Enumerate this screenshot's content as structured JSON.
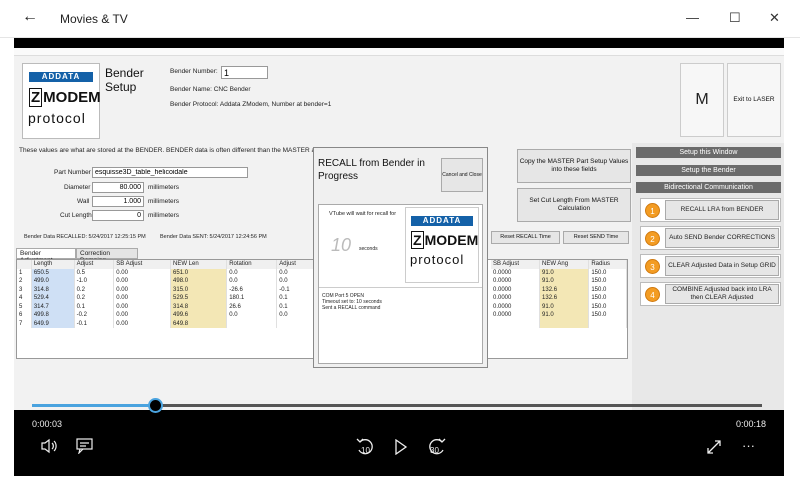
{
  "window": {
    "back": "←",
    "title": "Movies & TV",
    "min": "—",
    "max": "☐",
    "close": "✕"
  },
  "header": {
    "bender_setup_l1": "Bender",
    "bender_setup_l2": "Setup",
    "bender_number_label": "Bender Number:",
    "bender_number_value": "1",
    "bender_name": "Bender Name: CNC Bender",
    "bender_protocol": "Bender Protocol: Addata ZModem, Number at bender=1",
    "m_label": "M",
    "exit_label": "Exit to LASER"
  },
  "logo": {
    "brand": "ADDATA",
    "z": "Z",
    "modem": "MODEM",
    "protocol": "protocol"
  },
  "info": {
    "note": "These values are what are stored at the BENDER.  BENDER data is often different than the MASTER and",
    "part_label": "Part Number",
    "part_value": "esquisse3D_table_helicoidale",
    "diam_label": "Diameter",
    "diam_value": "80.000",
    "diam_unit": "millimeters",
    "wall_label": "Wall",
    "wall_value": "1.000",
    "wall_unit": "millimeters",
    "cut_label": "Cut Length",
    "cut_value": "0",
    "cut_unit": "millimeters",
    "recalled": "Bender Data RECALLED:  5/24/2017 12:25:15 PM",
    "sent": "Bender Data SENT:  5/24/2017 12:24:56 PM"
  },
  "buttons": {
    "copy_master": "Copy the MASTER Part Setup Values into these fields",
    "set_cut": "Set Cut Length From MASTER Calculation",
    "reset_recall": "Reset RECALL Time",
    "reset_send": "Reset SEND Time"
  },
  "right": {
    "h1": "Setup this Window",
    "h2": "Setup the Bender",
    "h3": "Bidirectional Communication",
    "actions": [
      {
        "num": "1",
        "label": "RECALL LRA from BENDER"
      },
      {
        "num": "2",
        "label": "Auto SEND Bender CORRECTIONS"
      },
      {
        "num": "3",
        "label": "CLEAR Adjusted Data in Setup GRID"
      },
      {
        "num": "4",
        "label": "COMBINE Adjusted back into LRA then CLEAR Adjusted"
      }
    ]
  },
  "tabs": [
    "Bender Adjustment",
    "Correction Damping"
  ],
  "grid": {
    "headers": [
      "",
      "Length",
      "Adjust",
      "SB Adjust",
      "NEW Len",
      "Rotation",
      "Adjust"
    ],
    "rows": [
      [
        "1",
        "650.5",
        "0.5",
        "0.00",
        "651.0",
        "0.0",
        "0.0"
      ],
      [
        "2",
        "499.0",
        "-1.0",
        "0.00",
        "498.0",
        "0.0",
        "0.0"
      ],
      [
        "3",
        "314.8",
        "0.2",
        "0.00",
        "315.0",
        "-26.6",
        "-0.1"
      ],
      [
        "4",
        "529.4",
        "0.2",
        "0.00",
        "529.5",
        "180.1",
        "0.1"
      ],
      [
        "5",
        "314.7",
        "0.1",
        "0.00",
        "314.8",
        "26.6",
        "0.1"
      ],
      [
        "6",
        "499.8",
        "-0.2",
        "0.00",
        "499.6",
        "0.0",
        "0.0"
      ],
      [
        "7",
        "649.9",
        "-0.1",
        "0.00",
        "649.8",
        "",
        ""
      ]
    ],
    "headers2": [
      "SB Adjust",
      "NEW Ang",
      "Radius"
    ],
    "rows2": [
      [
        "0.0000",
        "91.0",
        "150.0"
      ],
      [
        "0.0000",
        "91.0",
        "150.0"
      ],
      [
        "0.0000",
        "132.6",
        "150.0"
      ],
      [
        "0.0000",
        "132.6",
        "150.0"
      ],
      [
        "0.0000",
        "91.0",
        "150.0"
      ],
      [
        "0.0000",
        "91.0",
        "150.0"
      ],
      [
        "",
        "",
        ""
      ]
    ]
  },
  "dialog": {
    "title": "RECALL from Bender in Progress",
    "cancel": "Cancel and Close",
    "wait": "VTube will wait for recall for",
    "seconds_value": "10",
    "seconds_label": "seconds",
    "log": [
      "COM Port 5 OPEN",
      "Timeout set to: 10 seconds",
      "Sent a RECALL command"
    ]
  },
  "player": {
    "time_left": "0:00:03",
    "time_right": "0:00:18",
    "progress": 0.17,
    "skip_back": "10",
    "skip_fwd": "30"
  }
}
